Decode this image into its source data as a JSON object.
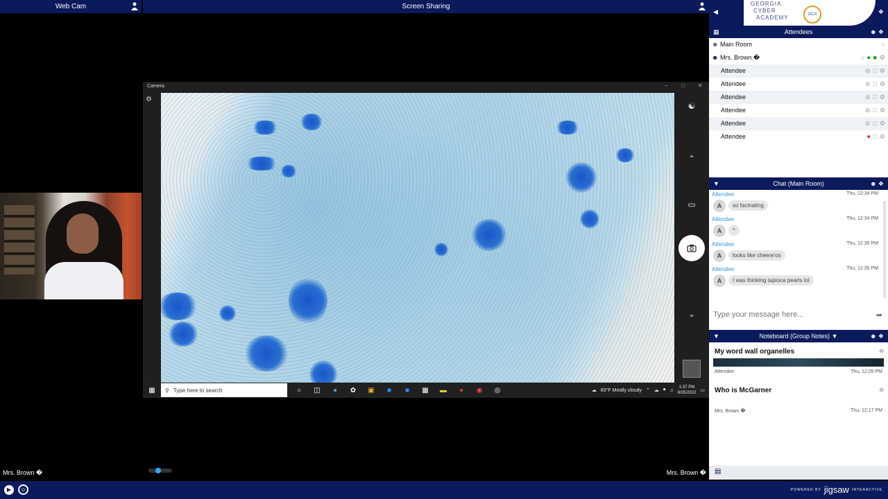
{
  "webcam": {
    "title": "Web Cam",
    "presenter": "Mrs. Brown �"
  },
  "share": {
    "title": "Screen Sharing",
    "presenter": "Mrs. Brown �",
    "camera_window_title": "Camera",
    "taskbar": {
      "search_placeholder": "Type here to search",
      "weather": "83°F  Mostly cloudy",
      "time": "1:37 PM",
      "date": "8/25/2022"
    }
  },
  "logo": {
    "line1": "GEORGIA",
    "line2": "CYBER",
    "line3": "ACADEMY",
    "seal": "GCA"
  },
  "attendees_panel": {
    "title": "Attendees",
    "room": "Main Room",
    "host": "Mrs. Brown �",
    "items": [
      "Attendee",
      "Attendee",
      "Attendee",
      "Attendee",
      "Attendee",
      "Attendee"
    ]
  },
  "chat": {
    "title": "Chat (Main Room)",
    "messages": [
      {
        "author": "Attendee",
        "time": "Thu, 12:34 PM",
        "avatar": "A",
        "text": "so facinating"
      },
      {
        "author": "Attendee",
        "time": "Thu, 12:34 PM",
        "avatar": "A",
        "text": "^"
      },
      {
        "author": "Attendee",
        "time": "Thu, 12:35 PM",
        "avatar": "A",
        "text": "looks like cheere'os"
      },
      {
        "author": "Attendee",
        "time": "Thu, 12:35 PM",
        "avatar": "A",
        "text": "I was thinking tapioca pearls lol"
      }
    ],
    "input_placeholder": "Type your message here..."
  },
  "noteboard": {
    "title": "Noteboard (Group Notes)",
    "notes": [
      {
        "title": "My word wall organelles",
        "author": "Attendee",
        "time": "Thu, 12:05 PM"
      },
      {
        "title": "Who is McGarner",
        "author": "Mrs. Brown �",
        "time": "Thu, 12:17 PM"
      }
    ]
  },
  "brand": {
    "powered": "POWERED BY",
    "name": "jigsaw",
    "sub": "INTERACTIVE"
  },
  "colors": {
    "header_navy": "#0b1a5c",
    "stain_blue": "#1856c8",
    "chat_author": "#3b8fd6"
  }
}
